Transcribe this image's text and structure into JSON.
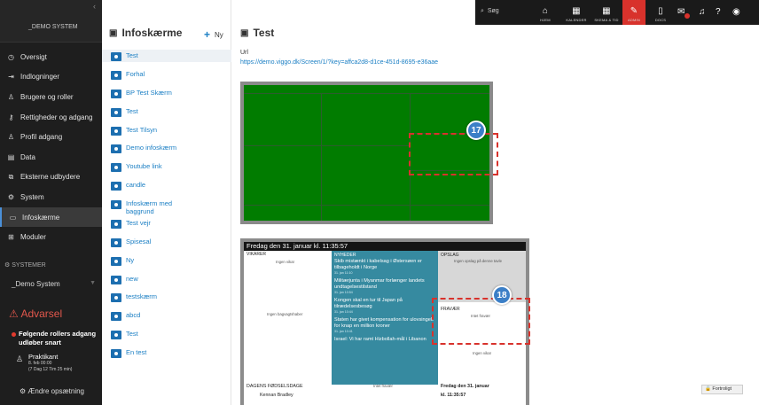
{
  "sidebar": {
    "system_name": "_DEMO SYSTEM",
    "items": [
      {
        "label": "Oversigt",
        "icon": "dashboard-icon"
      },
      {
        "label": "Indlogninger",
        "icon": "login-icon"
      },
      {
        "label": "Brugere og roller",
        "icon": "users-icon"
      },
      {
        "label": "Rettigheder og adgang",
        "icon": "key-icon"
      },
      {
        "label": "Profil adgang",
        "icon": "profile-icon"
      },
      {
        "label": "Data",
        "icon": "database-icon"
      },
      {
        "label": "Eksterne udbydere",
        "icon": "external-icon"
      },
      {
        "label": "System",
        "icon": "gear-icon"
      },
      {
        "label": "Infoskærme",
        "icon": "screen-icon"
      },
      {
        "label": "Moduler",
        "icon": "modules-icon"
      }
    ],
    "systems_label": "SYSTEMER",
    "system_select": "_Demo System",
    "warning_title": "Advarsel",
    "warning_item": "Følgende rollers adgang udløber snart",
    "practicant_name": "Praktikant",
    "practicant_date": "8. feb 00:00",
    "practicant_remaining": "(7 Dag 12 Tim 25 min)",
    "change_setting": "Ændre opsætning"
  },
  "topbar": {
    "search_label": "Søg",
    "buttons": [
      "HJEM",
      "KALENDER",
      "SKEMA & TID",
      "ADMIN",
      "DOCS"
    ],
    "message_badge": "1"
  },
  "list": {
    "title": "Infoskærme",
    "new_label": "Ny",
    "items": [
      "Test",
      "Forhal",
      "BP Test Skærm",
      "Test",
      "Test Tilsyn",
      "Demo infoskærm",
      "Youtube link",
      "candle",
      "Infoskærm med baggrund",
      "Test vejr",
      "Spisesal",
      "Ny",
      "new",
      "testskærm",
      "abcd",
      "Test",
      "En test"
    ]
  },
  "main": {
    "title": "Test",
    "url_label": "Url",
    "url": "https://demo.viggo.dk/Screen/1/?key=affca2d8-d1ce-451d-8695-e36aae",
    "marker1": "17",
    "marker2": "18"
  },
  "preview": {
    "header": "Fredag den 31. januar   kl. 11:35:57",
    "vikarer": "VIKARER",
    "ingen_vikar": "Ingen vikar",
    "ingen_bagvagt": "Ingen bagvagtshaber",
    "nyheder": "NYHEDER",
    "news": [
      {
        "title": "Skib mistænkt i kabelsag i Østersøen er tilbageholdt i Norge",
        "date": "31. jan 11:10"
      },
      {
        "title": "Militærjunta i Myanmar forlænger landets undtagelsestilstand",
        "date": "31. jan 10:54"
      },
      {
        "title": "Kongen skal en tur til Japan på tilrædelsesbesøg",
        "date": "31. jan 10:44"
      },
      {
        "title": "Staten har givet kompensation for ulovsingelt for knap en million kroner",
        "date": "31. jan 10:41"
      },
      {
        "title": "Israel: Vi har ramt Hizbollah-mål i Libanon",
        "date": ""
      }
    ],
    "opslag": "OPSLAG",
    "ingen_opslag": "Ingen opslag på denne tavle",
    "fravaer": "FRAVÆR",
    "intet_fravaer": "Intet fravær",
    "ingen_vikar2": "Ingen vikar",
    "dagens": "DAGENS FØDSELSDAGE",
    "intet_fravaer2": "Intet fravær",
    "footer_date": "Fredag den 31. januar",
    "footer_time": "kl. 11:35:57",
    "partial_name": "Kennan Bradley"
  },
  "fortrolig": "Fortroligt"
}
